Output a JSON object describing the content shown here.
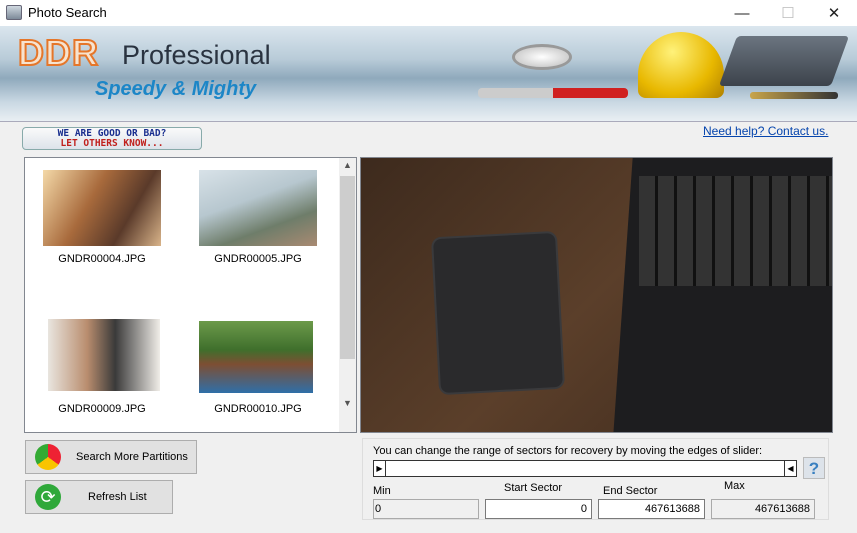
{
  "window": {
    "title": "Photo Search",
    "minimize": "—",
    "maximize": "☐",
    "close": "✕"
  },
  "banner": {
    "brand": "DDR",
    "product": "Professional",
    "tagline": "Speedy & Mighty"
  },
  "feedback": {
    "line1": "WE ARE GOOD OR BAD?",
    "line2": "LET OTHERS KNOW..."
  },
  "help_link": "Need help? Contact us.",
  "files": [
    {
      "name": "GNDR00004.JPG"
    },
    {
      "name": "GNDR00005.JPG"
    },
    {
      "name": "GNDR00009.JPG"
    },
    {
      "name": "GNDR00010.JPG"
    }
  ],
  "buttons": {
    "search_more": "Search More Partitions",
    "refresh": "Refresh List"
  },
  "sectors": {
    "instruction": "You can change the range of sectors for recovery by moving the edges of slider:",
    "help": "?",
    "min_label": "Min",
    "min_value": "0",
    "start_label": "Start Sector",
    "start_value": "0",
    "end_label": "End Sector",
    "end_value": "467613688",
    "max_label": "Max",
    "max_value": "467613688"
  }
}
